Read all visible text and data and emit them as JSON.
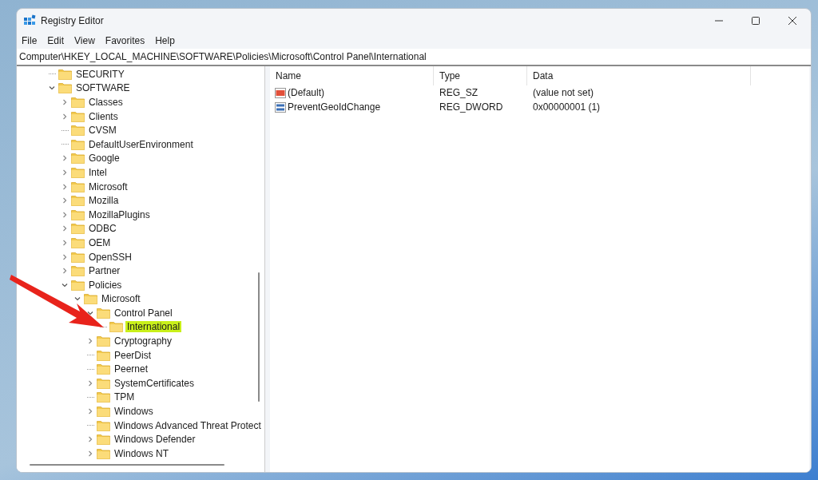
{
  "window": {
    "title": "Registry Editor"
  },
  "menu": [
    "File",
    "Edit",
    "View",
    "Favorites",
    "Help"
  ],
  "address": "Computer\\HKEY_LOCAL_MACHINE\\SOFTWARE\\Policies\\Microsoft\\Control Panel\\International",
  "tree": [
    {
      "label": "SECURITY",
      "kind": "leaf",
      "selected": false
    },
    {
      "label": "SOFTWARE",
      "kind": "branch",
      "expanded": true,
      "selected": false,
      "children": [
        {
          "label": "Classes",
          "kind": "branch",
          "expanded": false,
          "selected": false
        },
        {
          "label": "Clients",
          "kind": "branch",
          "expanded": false,
          "selected": false
        },
        {
          "label": "CVSM",
          "kind": "leaf",
          "selected": false
        },
        {
          "label": "DefaultUserEnvironment",
          "kind": "leaf",
          "selected": false
        },
        {
          "label": "Google",
          "kind": "branch",
          "expanded": false,
          "selected": false
        },
        {
          "label": "Intel",
          "kind": "branch",
          "expanded": false,
          "selected": false
        },
        {
          "label": "Microsoft",
          "kind": "branch",
          "expanded": false,
          "selected": false
        },
        {
          "label": "Mozilla",
          "kind": "branch",
          "expanded": false,
          "selected": false
        },
        {
          "label": "MozillaPlugins",
          "kind": "branch",
          "expanded": false,
          "selected": false
        },
        {
          "label": "ODBC",
          "kind": "branch",
          "expanded": false,
          "selected": false
        },
        {
          "label": "OEM",
          "kind": "branch",
          "expanded": false,
          "selected": false
        },
        {
          "label": "OpenSSH",
          "kind": "branch",
          "expanded": false,
          "selected": false
        },
        {
          "label": "Partner",
          "kind": "branch",
          "expanded": false,
          "selected": false
        },
        {
          "label": "Policies",
          "kind": "branch",
          "expanded": true,
          "selected": false,
          "children": [
            {
              "label": "Microsoft",
              "kind": "branch",
              "expanded": true,
              "selected": false,
              "children": [
                {
                  "label": "Control Panel",
                  "kind": "branch",
                  "expanded": true,
                  "selected": false,
                  "children": [
                    {
                      "label": "International",
                      "kind": "leaf",
                      "selected": true
                    }
                  ]
                },
                {
                  "label": "Cryptography",
                  "kind": "branch",
                  "expanded": false,
                  "selected": false
                },
                {
                  "label": "PeerDist",
                  "kind": "leaf",
                  "selected": false
                },
                {
                  "label": "Peernet",
                  "kind": "leaf",
                  "selected": false
                },
                {
                  "label": "SystemCertificates",
                  "kind": "branch",
                  "expanded": false,
                  "selected": false
                },
                {
                  "label": "TPM",
                  "kind": "leaf",
                  "selected": false
                },
                {
                  "label": "Windows",
                  "kind": "branch",
                  "expanded": false,
                  "selected": false
                },
                {
                  "label": "Windows Advanced Threat Protect",
                  "kind": "leaf",
                  "selected": false
                },
                {
                  "label": "Windows Defender",
                  "kind": "branch",
                  "expanded": false,
                  "selected": false
                },
                {
                  "label": "Windows NT",
                  "kind": "branch",
                  "expanded": false,
                  "selected": false
                }
              ]
            }
          ]
        }
      ]
    }
  ],
  "values": {
    "columns": [
      "Name",
      "Type",
      "Data"
    ],
    "rows": [
      {
        "kind": "string",
        "name": "(Default)",
        "type": "REG_SZ",
        "data": "(value not set)"
      },
      {
        "kind": "binary",
        "name": "PreventGeoIdChange",
        "type": "REG_DWORD",
        "data": "0x00000001 (1)"
      }
    ]
  }
}
